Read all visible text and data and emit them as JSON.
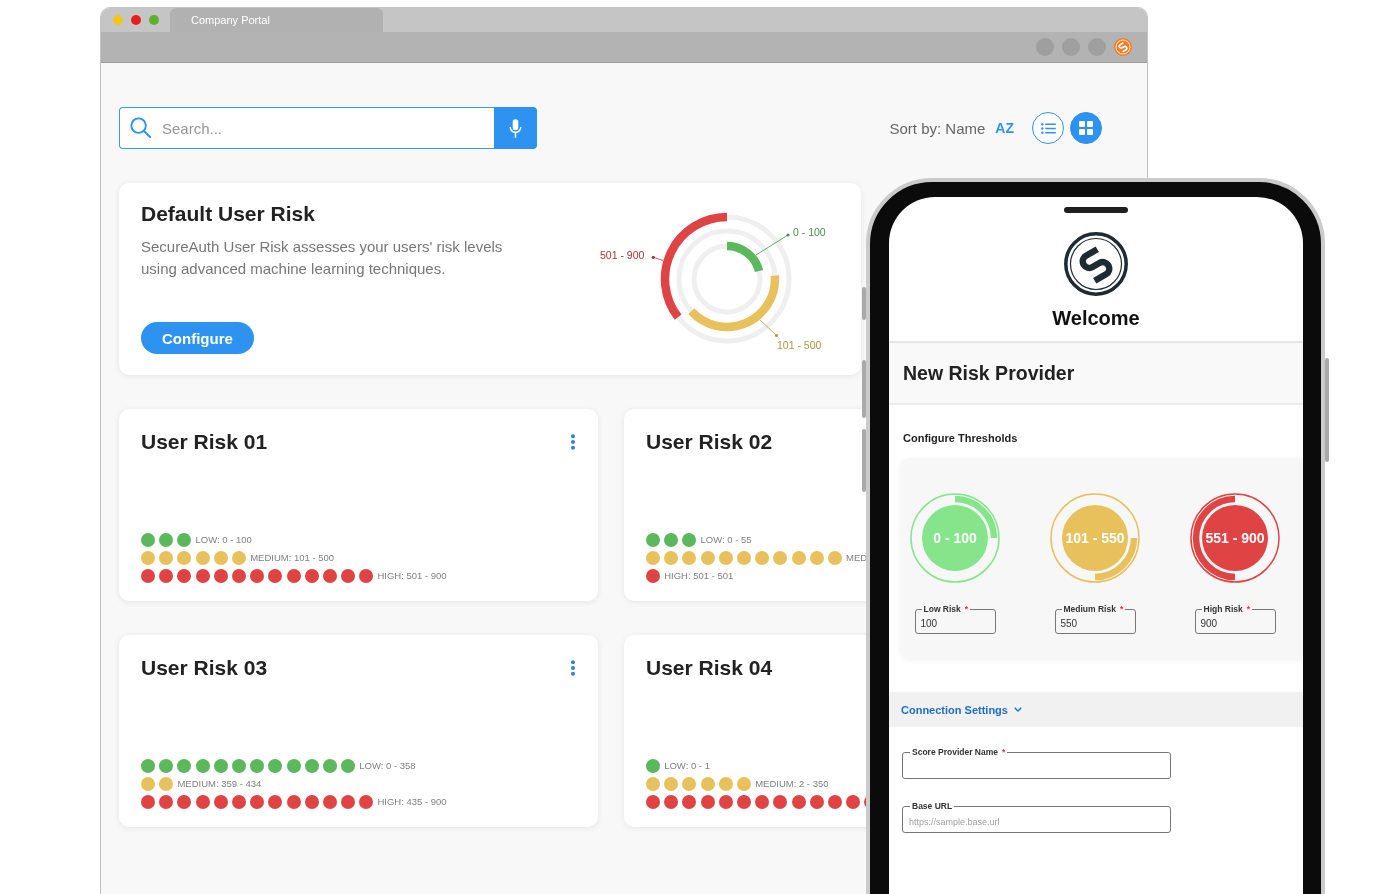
{
  "browser": {
    "window_controls": [
      {
        "color": "#f5c518"
      },
      {
        "color": "#e81e1e"
      },
      {
        "color": "#5fae2e"
      }
    ],
    "tab": "Company Portal"
  },
  "search": {
    "placeholder": "Search..."
  },
  "sort": {
    "label": "Sort by: Name",
    "order": "AZ"
  },
  "views": [
    {
      "kind": "list",
      "selected": false
    },
    {
      "kind": "grid",
      "selected": true
    }
  ],
  "default_risk": {
    "title": "Default User Risk",
    "description": "SecureAuth User Risk assesses your users' risk levels using advanced machine learning techniques.",
    "button": "Configure",
    "rings": [
      {
        "label": "0 - 100",
        "color": "#5cb85c"
      },
      {
        "label": "101 - 500",
        "color": "#e8c15d"
      },
      {
        "label": "501 - 900",
        "color": "#e04343"
      }
    ]
  },
  "cards": [
    {
      "title": "User Risk 01",
      "menu": true,
      "rows": [
        {
          "label": "LOW: 0 - 100",
          "dots": [
            {
              "color": "#5cb85c"
            },
            {
              "color": "#5cb85c"
            },
            {
              "color": "#5cb85c"
            }
          ]
        },
        {
          "label": "MEDIUM: 101 - 500",
          "dots": [
            {
              "color": "#e8c15d"
            },
            {
              "color": "#e8c15d"
            },
            {
              "color": "#e8c15d"
            },
            {
              "color": "#e8c15d"
            },
            {
              "color": "#e8c15d"
            },
            {
              "color": "#e8c15d"
            }
          ]
        },
        {
          "label": "HIGH: 501 - 900",
          "dots": [
            {
              "color": "#e04343"
            },
            {
              "color": "#e04343"
            },
            {
              "color": "#e04343"
            },
            {
              "color": "#e04343"
            },
            {
              "color": "#e04343"
            },
            {
              "color": "#e04343"
            },
            {
              "color": "#e04343"
            },
            {
              "color": "#e04343"
            },
            {
              "color": "#e04343"
            },
            {
              "color": "#e04343"
            },
            {
              "color": "#e04343"
            },
            {
              "color": "#e04343"
            },
            {
              "color": "#e04343"
            }
          ]
        }
      ]
    },
    {
      "title": "User Risk 02",
      "menu": false,
      "rows": [
        {
          "label": "LOW: 0 - 55",
          "dots": [
            {
              "color": "#5cb85c"
            },
            {
              "color": "#5cb85c"
            },
            {
              "color": "#5cb85c"
            }
          ]
        },
        {
          "label": "MED",
          "dots": [
            {
              "color": "#e8c15d"
            },
            {
              "color": "#e8c15d"
            },
            {
              "color": "#e8c15d"
            },
            {
              "color": "#e8c15d"
            },
            {
              "color": "#e8c15d"
            },
            {
              "color": "#e8c15d"
            },
            {
              "color": "#e8c15d"
            },
            {
              "color": "#e8c15d"
            },
            {
              "color": "#e8c15d"
            },
            {
              "color": "#e8c15d"
            },
            {
              "color": "#e8c15d"
            }
          ]
        },
        {
          "label": "HIGH: 501 - 501",
          "dots": [
            {
              "color": "#e04343"
            }
          ]
        }
      ]
    },
    {
      "title": "User Risk 03",
      "menu": true,
      "rows": [
        {
          "label": "LOW: 0 - 358",
          "dots": [
            {
              "color": "#5cb85c"
            },
            {
              "color": "#5cb85c"
            },
            {
              "color": "#5cb85c"
            },
            {
              "color": "#5cb85c"
            },
            {
              "color": "#5cb85c"
            },
            {
              "color": "#5cb85c"
            },
            {
              "color": "#5cb85c"
            },
            {
              "color": "#5cb85c"
            },
            {
              "color": "#5cb85c"
            },
            {
              "color": "#5cb85c"
            },
            {
              "color": "#5cb85c"
            },
            {
              "color": "#5cb85c"
            }
          ]
        },
        {
          "label": "MEDIUM: 359 - 434",
          "dots": [
            {
              "color": "#e8c15d"
            },
            {
              "color": "#e8c15d"
            }
          ]
        },
        {
          "label": "HIGH: 435 - 900",
          "dots": [
            {
              "color": "#e04343"
            },
            {
              "color": "#e04343"
            },
            {
              "color": "#e04343"
            },
            {
              "color": "#e04343"
            },
            {
              "color": "#e04343"
            },
            {
              "color": "#e04343"
            },
            {
              "color": "#e04343"
            },
            {
              "color": "#e04343"
            },
            {
              "color": "#e04343"
            },
            {
              "color": "#e04343"
            },
            {
              "color": "#e04343"
            },
            {
              "color": "#e04343"
            },
            {
              "color": "#e04343"
            }
          ]
        }
      ]
    },
    {
      "title": "User Risk 04",
      "menu": false,
      "rows": [
        {
          "label": "LOW: 0 - 1",
          "dots": [
            {
              "color": "#5cb85c"
            }
          ]
        },
        {
          "label": "MEDIUM: 2 - 350",
          "dots": [
            {
              "color": "#e8c15d"
            },
            {
              "color": "#e8c15d"
            },
            {
              "color": "#e8c15d"
            },
            {
              "color": "#e8c15d"
            },
            {
              "color": "#e8c15d"
            },
            {
              "color": "#e8c15d"
            }
          ]
        },
        {
          "dots": [
            {
              "color": "#e04343"
            },
            {
              "color": "#e04343"
            },
            {
              "color": "#e04343"
            },
            {
              "color": "#e04343"
            },
            {
              "color": "#e04343"
            },
            {
              "color": "#e04343"
            },
            {
              "color": "#e04343"
            },
            {
              "color": "#e04343"
            },
            {
              "color": "#e04343"
            },
            {
              "color": "#e04343"
            },
            {
              "color": "#e04343"
            },
            {
              "color": "#e04343"
            },
            {
              "color": "#e04343"
            }
          ]
        }
      ]
    }
  ],
  "phone": {
    "welcome": "Welcome",
    "page_title": "New Risk Provider",
    "section": "Configure Thresholds",
    "thresholds": [
      {
        "range": "0 - 100",
        "color": "#86e58b",
        "label": "Low Risk",
        "required_mark": "*",
        "value": "100"
      },
      {
        "range": "101 - 550",
        "color": "#e8c15d",
        "label": "Medium Risk",
        "required_mark": "*",
        "value": "550"
      },
      {
        "range": "551 - 900",
        "color": "#e04343",
        "label": "High Risk",
        "required_mark": "*",
        "value": "900"
      }
    ],
    "connection": {
      "title": "Connection Settings",
      "expanded": true
    },
    "fields": [
      {
        "label": "Score Provider Name",
        "required_mark": "*"
      },
      {
        "label": "Base URL",
        "placeholder": "https://sample.base.url"
      }
    ]
  }
}
